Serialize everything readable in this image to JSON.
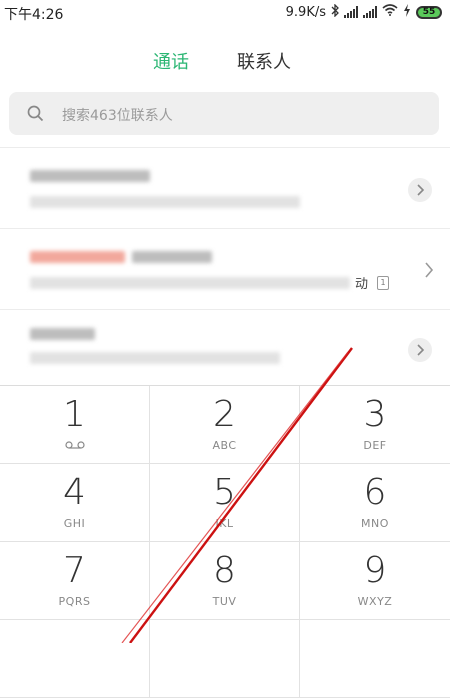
{
  "status_bar": {
    "time": "下午4:26",
    "net_speed": "9.9K/s",
    "battery": "55"
  },
  "tabs": [
    {
      "label": "通话",
      "active": true
    },
    {
      "label": "联系人",
      "active": false
    }
  ],
  "search": {
    "placeholder": "搜索463位联系人"
  },
  "call_list": {
    "row2_fragment": "动",
    "row2_sim": "1"
  },
  "keypad": [
    {
      "digit": "1",
      "letters": ""
    },
    {
      "digit": "2",
      "letters": "ABC"
    },
    {
      "digit": "3",
      "letters": "DEF"
    },
    {
      "digit": "4",
      "letters": "GHI"
    },
    {
      "digit": "5",
      "letters": "JKL"
    },
    {
      "digit": "6",
      "letters": "MNO"
    },
    {
      "digit": "7",
      "letters": "PQRS"
    },
    {
      "digit": "8",
      "letters": "TUV"
    },
    {
      "digit": "9",
      "letters": "WXYZ"
    }
  ],
  "colors": {
    "accent": "#2bb673",
    "annotation": "#cc1111"
  },
  "icons": [
    "bluetooth-icon",
    "signal-icon",
    "wifi-icon",
    "charging-icon",
    "battery-icon",
    "search-icon",
    "chevron-right-icon",
    "voicemail-icon"
  ]
}
